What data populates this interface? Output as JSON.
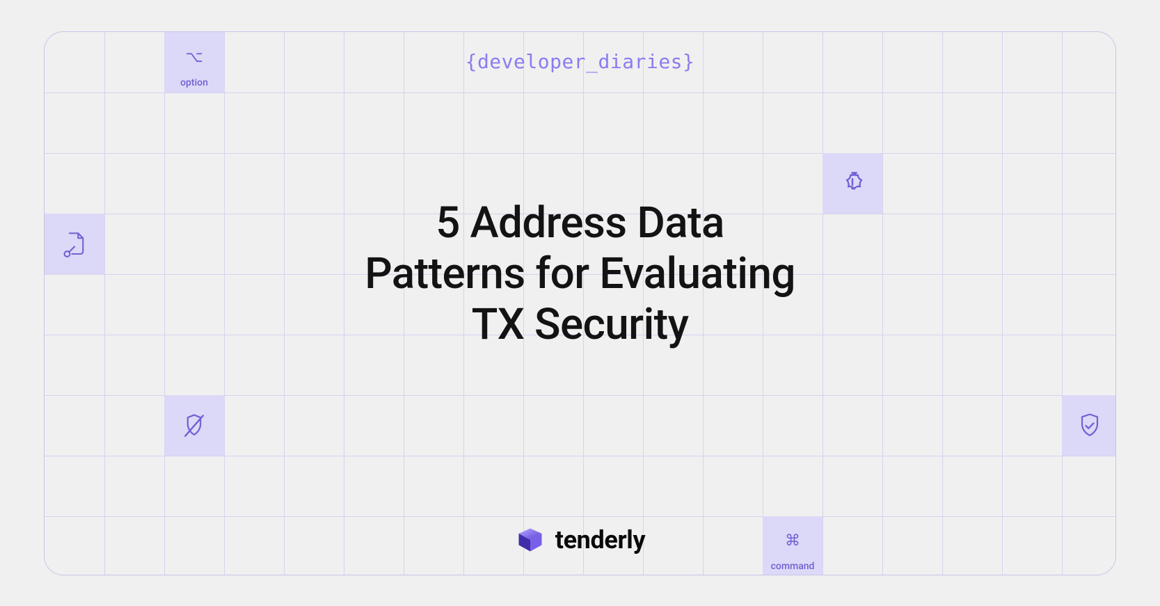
{
  "header_tag": "{developer_diaries}",
  "title": "5 Address Data\nPatterns for Evaluating\nTX Security",
  "brand": {
    "name": "tenderly"
  },
  "key_labels": {
    "option": "option",
    "command": "command"
  },
  "colors": {
    "accent": "#8a7cf0",
    "cell_fill": "#dcd8f7",
    "grid_line": "#d6d2ef",
    "icon_stroke": "#6f62d4",
    "background": "#f0f0f0",
    "text": "#131313"
  }
}
